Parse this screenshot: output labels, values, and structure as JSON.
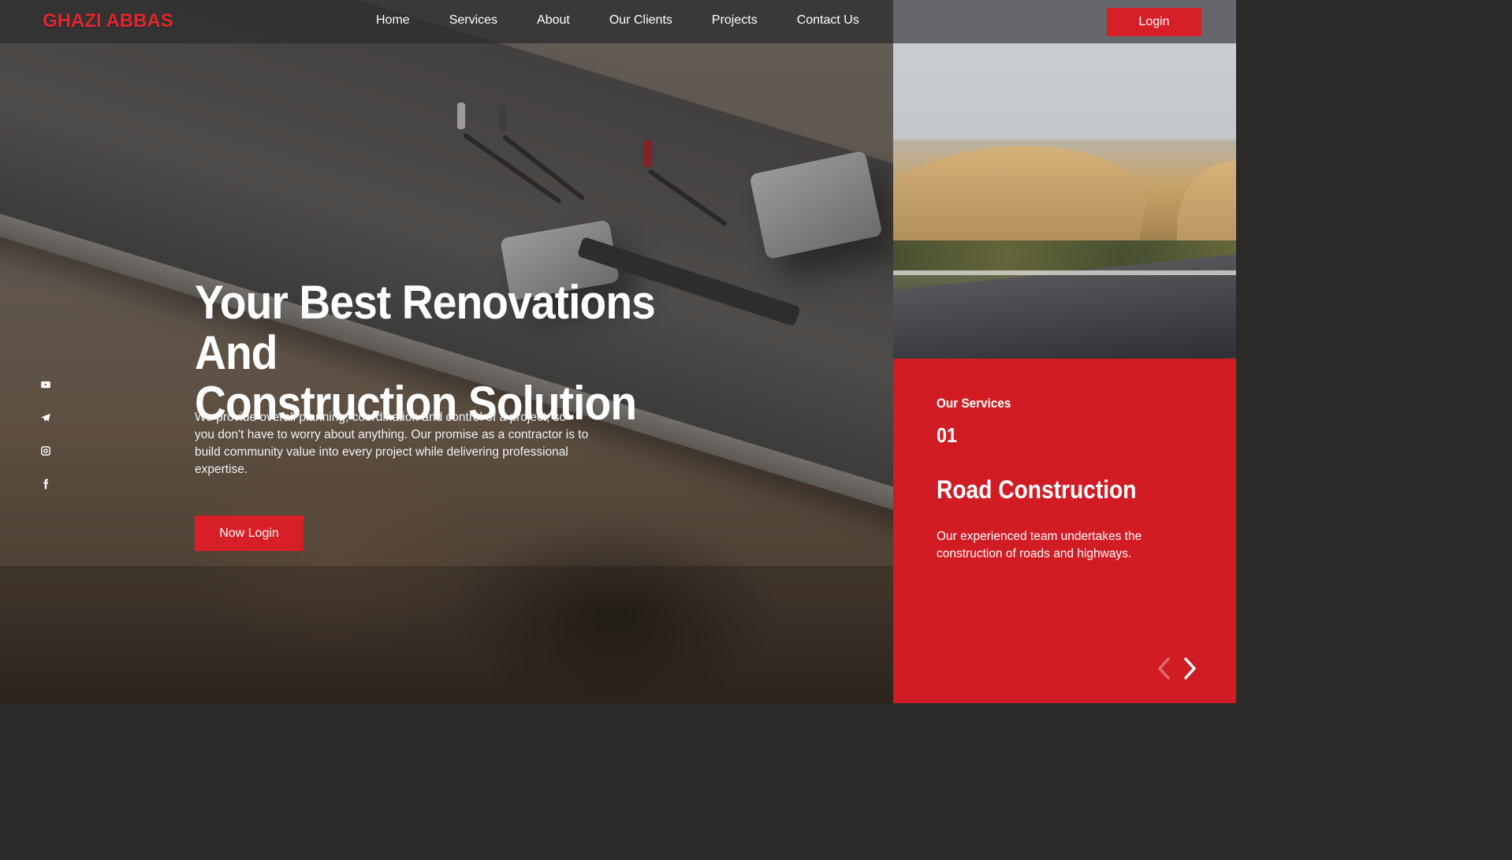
{
  "brand": {
    "name": "GHAZI ABBAS"
  },
  "nav": {
    "items": [
      {
        "label": "Home"
      },
      {
        "label": "Services"
      },
      {
        "label": "About"
      },
      {
        "label": "Our Clients"
      },
      {
        "label": "Projects"
      },
      {
        "label": "Contact Us"
      }
    ],
    "login_label": "Login"
  },
  "social": {
    "icons": [
      "youtube-icon",
      "telegram-icon",
      "instagram-icon",
      "facebook-icon"
    ]
  },
  "hero": {
    "title_line1": "Your Best Renovations And",
    "title_line2": "Construction Solution",
    "description": "We provide overall planning, coordination and control of a project, so you don't have to worry about anything. Our promise as a contractor is to build community value into every project while delivering professional expertise.",
    "cta_label": "Now Login"
  },
  "services": {
    "section_label": "Our Services",
    "index": "01",
    "title": "Road Construction",
    "description": "Our experienced team undertakes the construction of roads and highways."
  },
  "colors": {
    "accent": "#d71f27",
    "panel": "#d11c24",
    "nav_right": "#646669"
  }
}
